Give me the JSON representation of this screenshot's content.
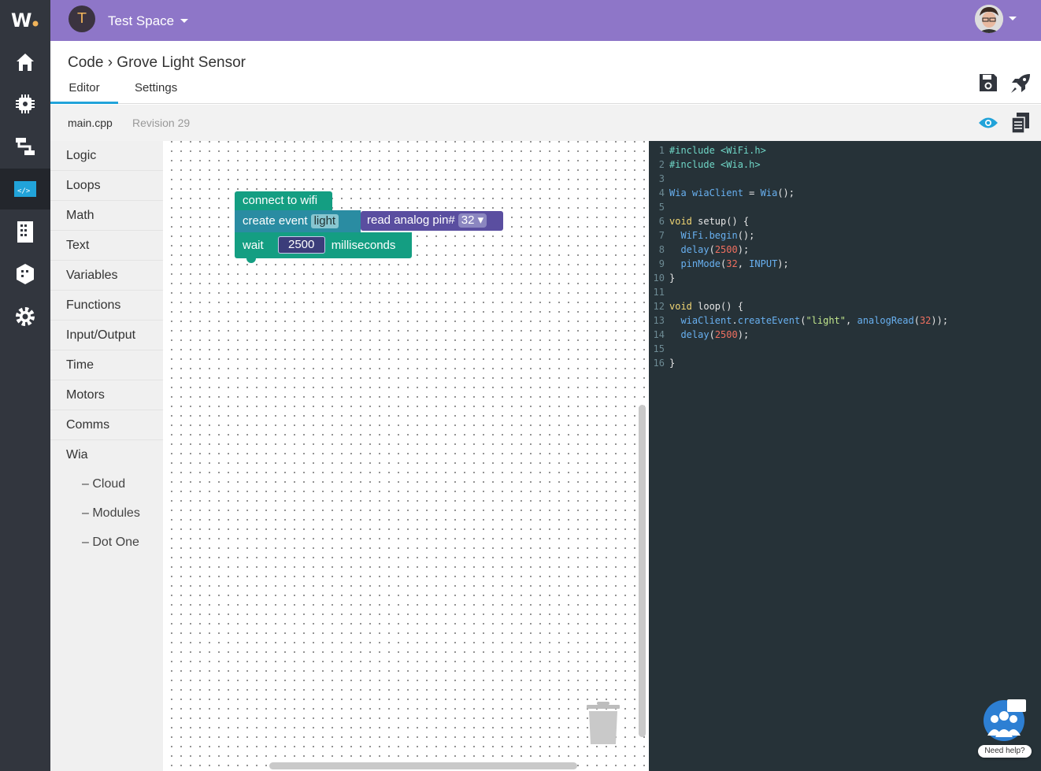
{
  "app": {
    "logo_icon": "wia-logo-icon"
  },
  "rail": {
    "items": [
      {
        "name": "home-icon"
      },
      {
        "name": "devices-icon"
      },
      {
        "name": "flows-icon"
      },
      {
        "name": "code-icon",
        "active": true
      },
      {
        "name": "buildings-icon"
      },
      {
        "name": "dashboards-icon"
      },
      {
        "name": "settings-gear-icon"
      }
    ]
  },
  "topbar": {
    "space_initial": "T",
    "space_name": "Test Space",
    "accent_color": "#8e76c8"
  },
  "header": {
    "breadcrumb": "Code › Grove Light Sensor",
    "tabs": [
      {
        "label": "Editor",
        "active": true
      },
      {
        "label": "Settings"
      }
    ],
    "actions": [
      "save-icon",
      "deploy-rocket-icon"
    ]
  },
  "filebar": {
    "filename": "main.cpp",
    "revision": "Revision 29"
  },
  "toolbox": {
    "categories": [
      "Logic",
      "Loops",
      "Math",
      "Text",
      "Variables",
      "Functions",
      "Input/Output",
      "Time",
      "Motors",
      "Comms",
      "Wia"
    ],
    "subcategories": [
      "– Cloud",
      "– Modules",
      "– Dot One"
    ]
  },
  "blocks": {
    "connect_wifi": "connect to wifi",
    "create_event": "create event",
    "event_name": "light",
    "read_analog": "read analog pin#",
    "pin_value": "32 ▾",
    "wait": "wait",
    "wait_ms": "2500",
    "milliseconds": "milliseconds"
  },
  "code": {
    "line_numbers": [
      "1",
      "2",
      "3",
      "4",
      "5",
      "6",
      "7",
      "8",
      "9",
      "10",
      "11",
      "12",
      "13",
      "14",
      "15",
      "16"
    ]
  },
  "help": {
    "label": "Need help?"
  }
}
